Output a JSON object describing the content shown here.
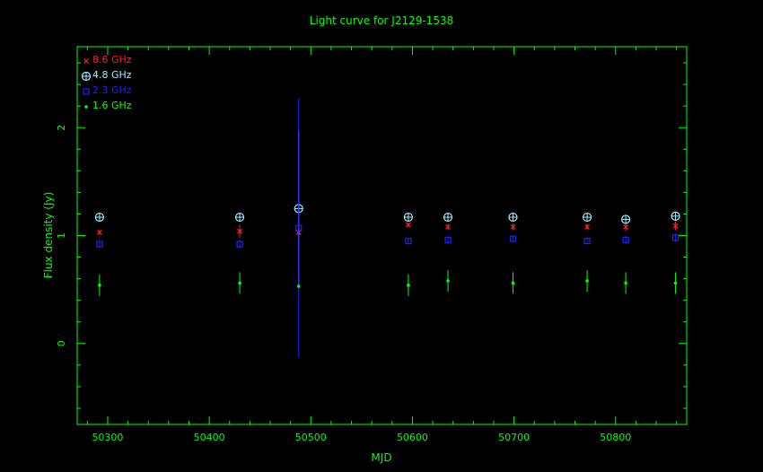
{
  "chart_data": {
    "type": "scatter",
    "title": "Light curve for J2129-1538",
    "xlabel": "MJD",
    "ylabel": "Flux density (Jy)",
    "xlim": [
      50270,
      50870
    ],
    "ylim": [
      -0.75,
      2.75
    ],
    "xticks": [
      50300,
      50400,
      50500,
      50600,
      50700,
      50800
    ],
    "yticks": [
      0,
      1,
      2
    ],
    "grid": false,
    "legend_position": "top-left",
    "frame_color": "#00ff00",
    "title_color": "#00ff00",
    "series": [
      {
        "name": "8.6 GHz",
        "color": "#ff2020",
        "marker": "x",
        "x": [
          50292,
          50430,
          50488,
          50596,
          50635,
          50699,
          50772,
          50810,
          50859
        ],
        "y": [
          1.03,
          1.04,
          1.03,
          1.1,
          1.08,
          1.08,
          1.08,
          1.08,
          1.09
        ],
        "err": [
          0.02,
          0.06,
          0.04,
          0.02,
          0.03,
          0.03,
          0.03,
          0.04,
          0.04
        ]
      },
      {
        "name": "4.8 GHz",
        "color": "#a0f0ff",
        "marker": "circle-plus",
        "x": [
          50292,
          50430,
          50488,
          50596,
          50635,
          50699,
          50772,
          50810,
          50859
        ],
        "y": [
          1.17,
          1.17,
          1.25,
          1.17,
          1.17,
          1.17,
          1.17,
          1.15,
          1.18
        ],
        "err": [
          0.0,
          0.0,
          0.72,
          0.0,
          0.0,
          0.0,
          0.0,
          0.0,
          0.0
        ]
      },
      {
        "name": "2.3 GHz",
        "color": "#2020ff",
        "marker": "square",
        "x": [
          50292,
          50430,
          50488,
          50596,
          50635,
          50699,
          50772,
          50810,
          50859
        ],
        "y": [
          0.92,
          0.92,
          1.07,
          0.95,
          0.96,
          0.97,
          0.95,
          0.96,
          0.98
        ],
        "err": [
          0.03,
          0.04,
          1.2,
          0.03,
          0.03,
          0.03,
          0.03,
          0.03,
          0.04
        ]
      },
      {
        "name": "1.6 GHz",
        "color": "#00ff00",
        "marker": "dot",
        "x": [
          50292,
          50430,
          50488,
          50596,
          50635,
          50699,
          50772,
          50810,
          50859
        ],
        "y": [
          0.54,
          0.56,
          0.53,
          0.54,
          0.58,
          0.56,
          0.58,
          0.56,
          0.56
        ],
        "err": [
          0.1,
          0.1,
          0.0,
          0.1,
          0.1,
          0.1,
          0.1,
          0.1,
          0.1
        ]
      }
    ]
  }
}
